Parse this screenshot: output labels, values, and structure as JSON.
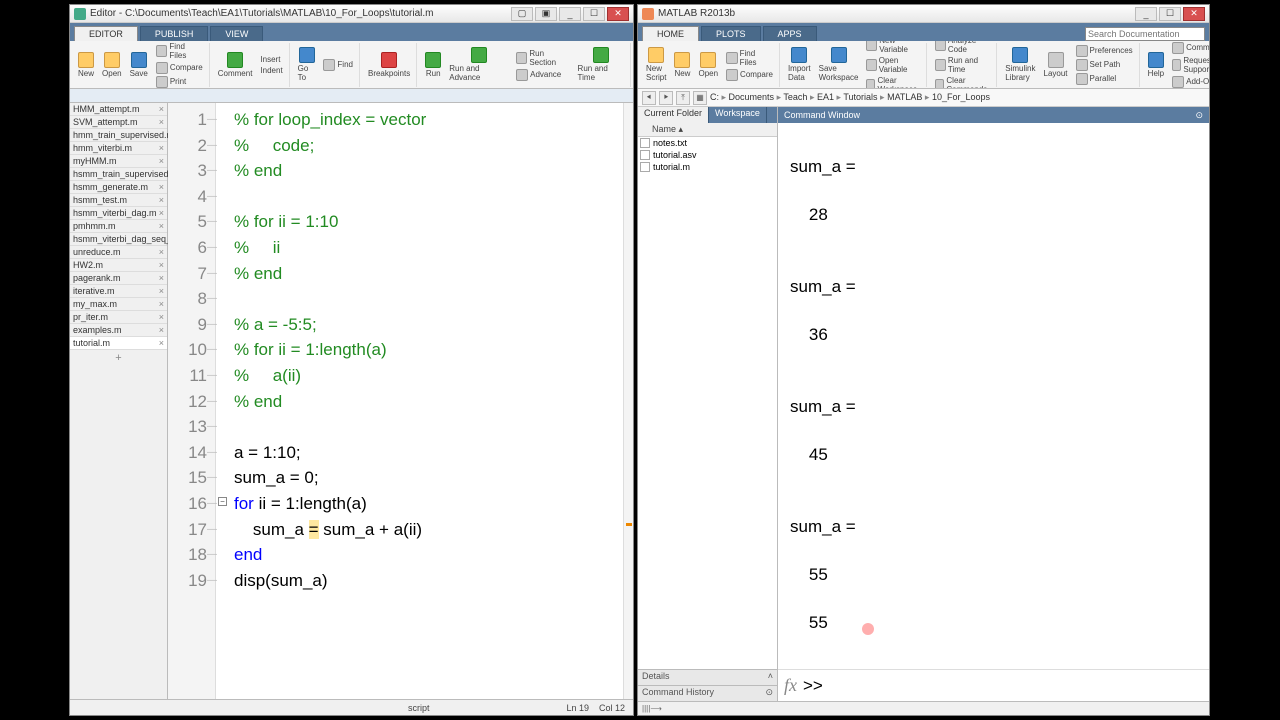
{
  "editor_window": {
    "title": "Editor - C:\\Documents\\Teach\\EA1\\Tutorials\\MATLAB\\10_For_Loops\\tutorial.m",
    "tabs": {
      "editor": "EDITOR",
      "publish": "PUBLISH",
      "view": "VIEW"
    },
    "toolstrip": {
      "new": "New",
      "open": "Open",
      "save": "Save",
      "findfiles": "Find Files",
      "compare": "Compare",
      "print": "Print",
      "comment": "Comment",
      "insert": "Insert",
      "indent": "Indent",
      "goto": "Go To",
      "find": "Find",
      "breakpoints": "Breakpoints",
      "run": "Run",
      "runadvance": "Run and Advance",
      "runsection": "Run Section",
      "advance": "Advance",
      "runtime": "Run and Time"
    },
    "open_files": [
      "HMM_attempt.m",
      "SVM_attempt.m",
      "hmm_train_supervised.m",
      "hmm_viterbi.m",
      "myHMM.m",
      "hsmm_train_supervised_...",
      "hsmm_generate.m",
      "hsmm_test.m",
      "hsmm_viterbi_dag.m",
      "pmhmm.m",
      "hsmm_viterbi_dag_seq_...",
      "unreduce.m",
      "HW2.m",
      "pagerank.m",
      "iterative.m",
      "my_max.m",
      "pr_iter.m",
      "examples.m",
      "tutorial.m"
    ],
    "active_file": "tutorial.m",
    "status": {
      "mode": "script",
      "ln": "Ln  19",
      "col": "Col  12"
    }
  },
  "matlab_window": {
    "title": "MATLAB R2013b",
    "tabs": {
      "home": "HOME",
      "plots": "PLOTS",
      "apps": "APPS"
    },
    "search_placeholder": "Search Documentation",
    "toolstrip": {
      "newscript": "New Script",
      "new": "New",
      "open": "Open",
      "findfiles": "Find Files",
      "compare": "Compare",
      "importdata": "Import Data",
      "savews": "Save Workspace",
      "newvar": "New Variable",
      "openvar": "Open Variable",
      "clearws": "Clear Workspace",
      "analyze": "Analyze Code",
      "runtime": "Run and Time",
      "clearcmd": "Clear Commands",
      "simulink": "Simulink Library",
      "layout": "Layout",
      "prefs": "Preferences",
      "setpath": "Set Path",
      "parallel": "Parallel",
      "help": "Help",
      "community": "Community",
      "support": "Request Support",
      "addons": "Add-Ons"
    },
    "breadcrumb": [
      "C:",
      "Documents",
      "Teach",
      "EA1",
      "Tutorials",
      "MATLAB",
      "10_For_Loops"
    ],
    "panel_tabs": {
      "current": "Current Folder",
      "workspace": "Workspace"
    },
    "filelist_header": "Name ▴",
    "files": [
      "notes.txt",
      "tutorial.asv",
      "tutorial.m"
    ],
    "details_label": "Details",
    "cmdhist_label": "Command History",
    "cmdwin_label": "Command Window",
    "prompt": ">>"
  },
  "code": {
    "lines": [
      {
        "n": 1,
        "html": "<span class='c'>% for loop_index = vector</span>"
      },
      {
        "n": 2,
        "html": "<span class='c'>%     code;</span>"
      },
      {
        "n": 3,
        "html": "<span class='c'>% end</span>"
      },
      {
        "n": 4,
        "html": ""
      },
      {
        "n": 5,
        "html": "<span class='c'>% for ii = 1:10</span>"
      },
      {
        "n": 6,
        "html": "<span class='c'>%     ii</span>"
      },
      {
        "n": 7,
        "html": "<span class='c'>% end</span>"
      },
      {
        "n": 8,
        "html": ""
      },
      {
        "n": 9,
        "html": "<span class='c'>% a = -5:5;</span>"
      },
      {
        "n": 10,
        "html": "<span class='c'>% for ii = 1:length(a)</span>"
      },
      {
        "n": 11,
        "html": "<span class='c'>%     a(ii)</span>"
      },
      {
        "n": 12,
        "html": "<span class='c'>% end</span>"
      },
      {
        "n": 13,
        "html": ""
      },
      {
        "n": 14,
        "html": "a = 1:10;"
      },
      {
        "n": 15,
        "html": "sum_a = 0;"
      },
      {
        "n": 16,
        "html": "<span class='k'>for</span> ii = 1:length(a)"
      },
      {
        "n": 17,
        "html": "    sum_a <span class='hl'>=</span> sum_a + a(ii)"
      },
      {
        "n": 18,
        "html": "<span class='k'>end</span>"
      },
      {
        "n": 19,
        "html": "disp(sum_a)"
      }
    ]
  },
  "cmd_output": "\nsum_a =\n\n    28\n\n\nsum_a =\n\n    36\n\n\nsum_a =\n\n    45\n\n\nsum_a =\n\n    55\n\n    55\n"
}
